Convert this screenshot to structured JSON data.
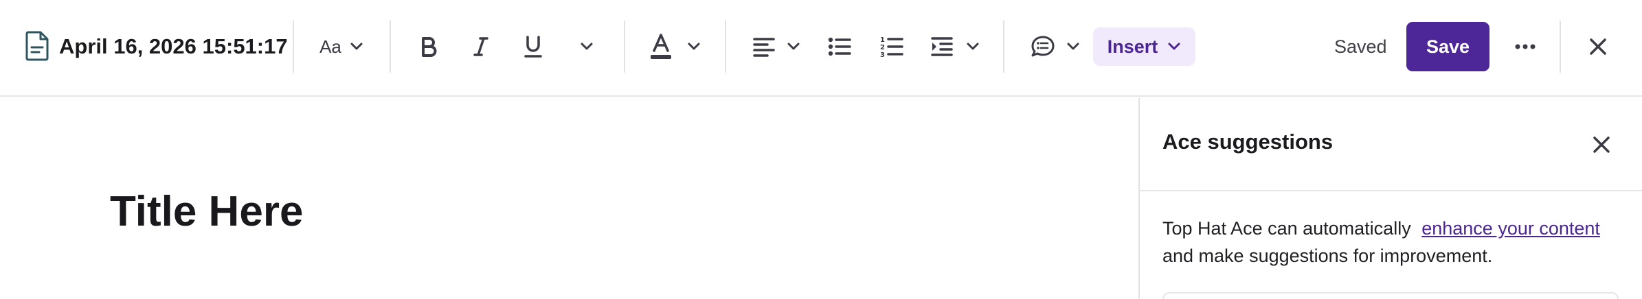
{
  "toolbar": {
    "doc_title": "April 16, 2026 15:51:17",
    "font_button_label": "Aa",
    "insert_label": "Insert",
    "saved_status": "Saved",
    "save_label": "Save",
    "icons": [
      "document-icon",
      "bold-icon",
      "italic-icon",
      "underline-icon",
      "text-color-icon",
      "align-left-icon",
      "bullet-list-icon",
      "numbered-list-icon",
      "indent-icon",
      "comment-icon",
      "more-icon",
      "close-icon"
    ],
    "colors": {
      "accent": "#4d2697",
      "insert_bg": "#f1eafd",
      "insert_text": "#4b2592"
    }
  },
  "editor": {
    "title": "Title Here"
  },
  "panel": {
    "title": "Ace suggestions",
    "body_before_link": "Top Hat Ace can automatically",
    "link_text": "enhance your content",
    "body_after_link": "and make suggestions for improvement."
  }
}
